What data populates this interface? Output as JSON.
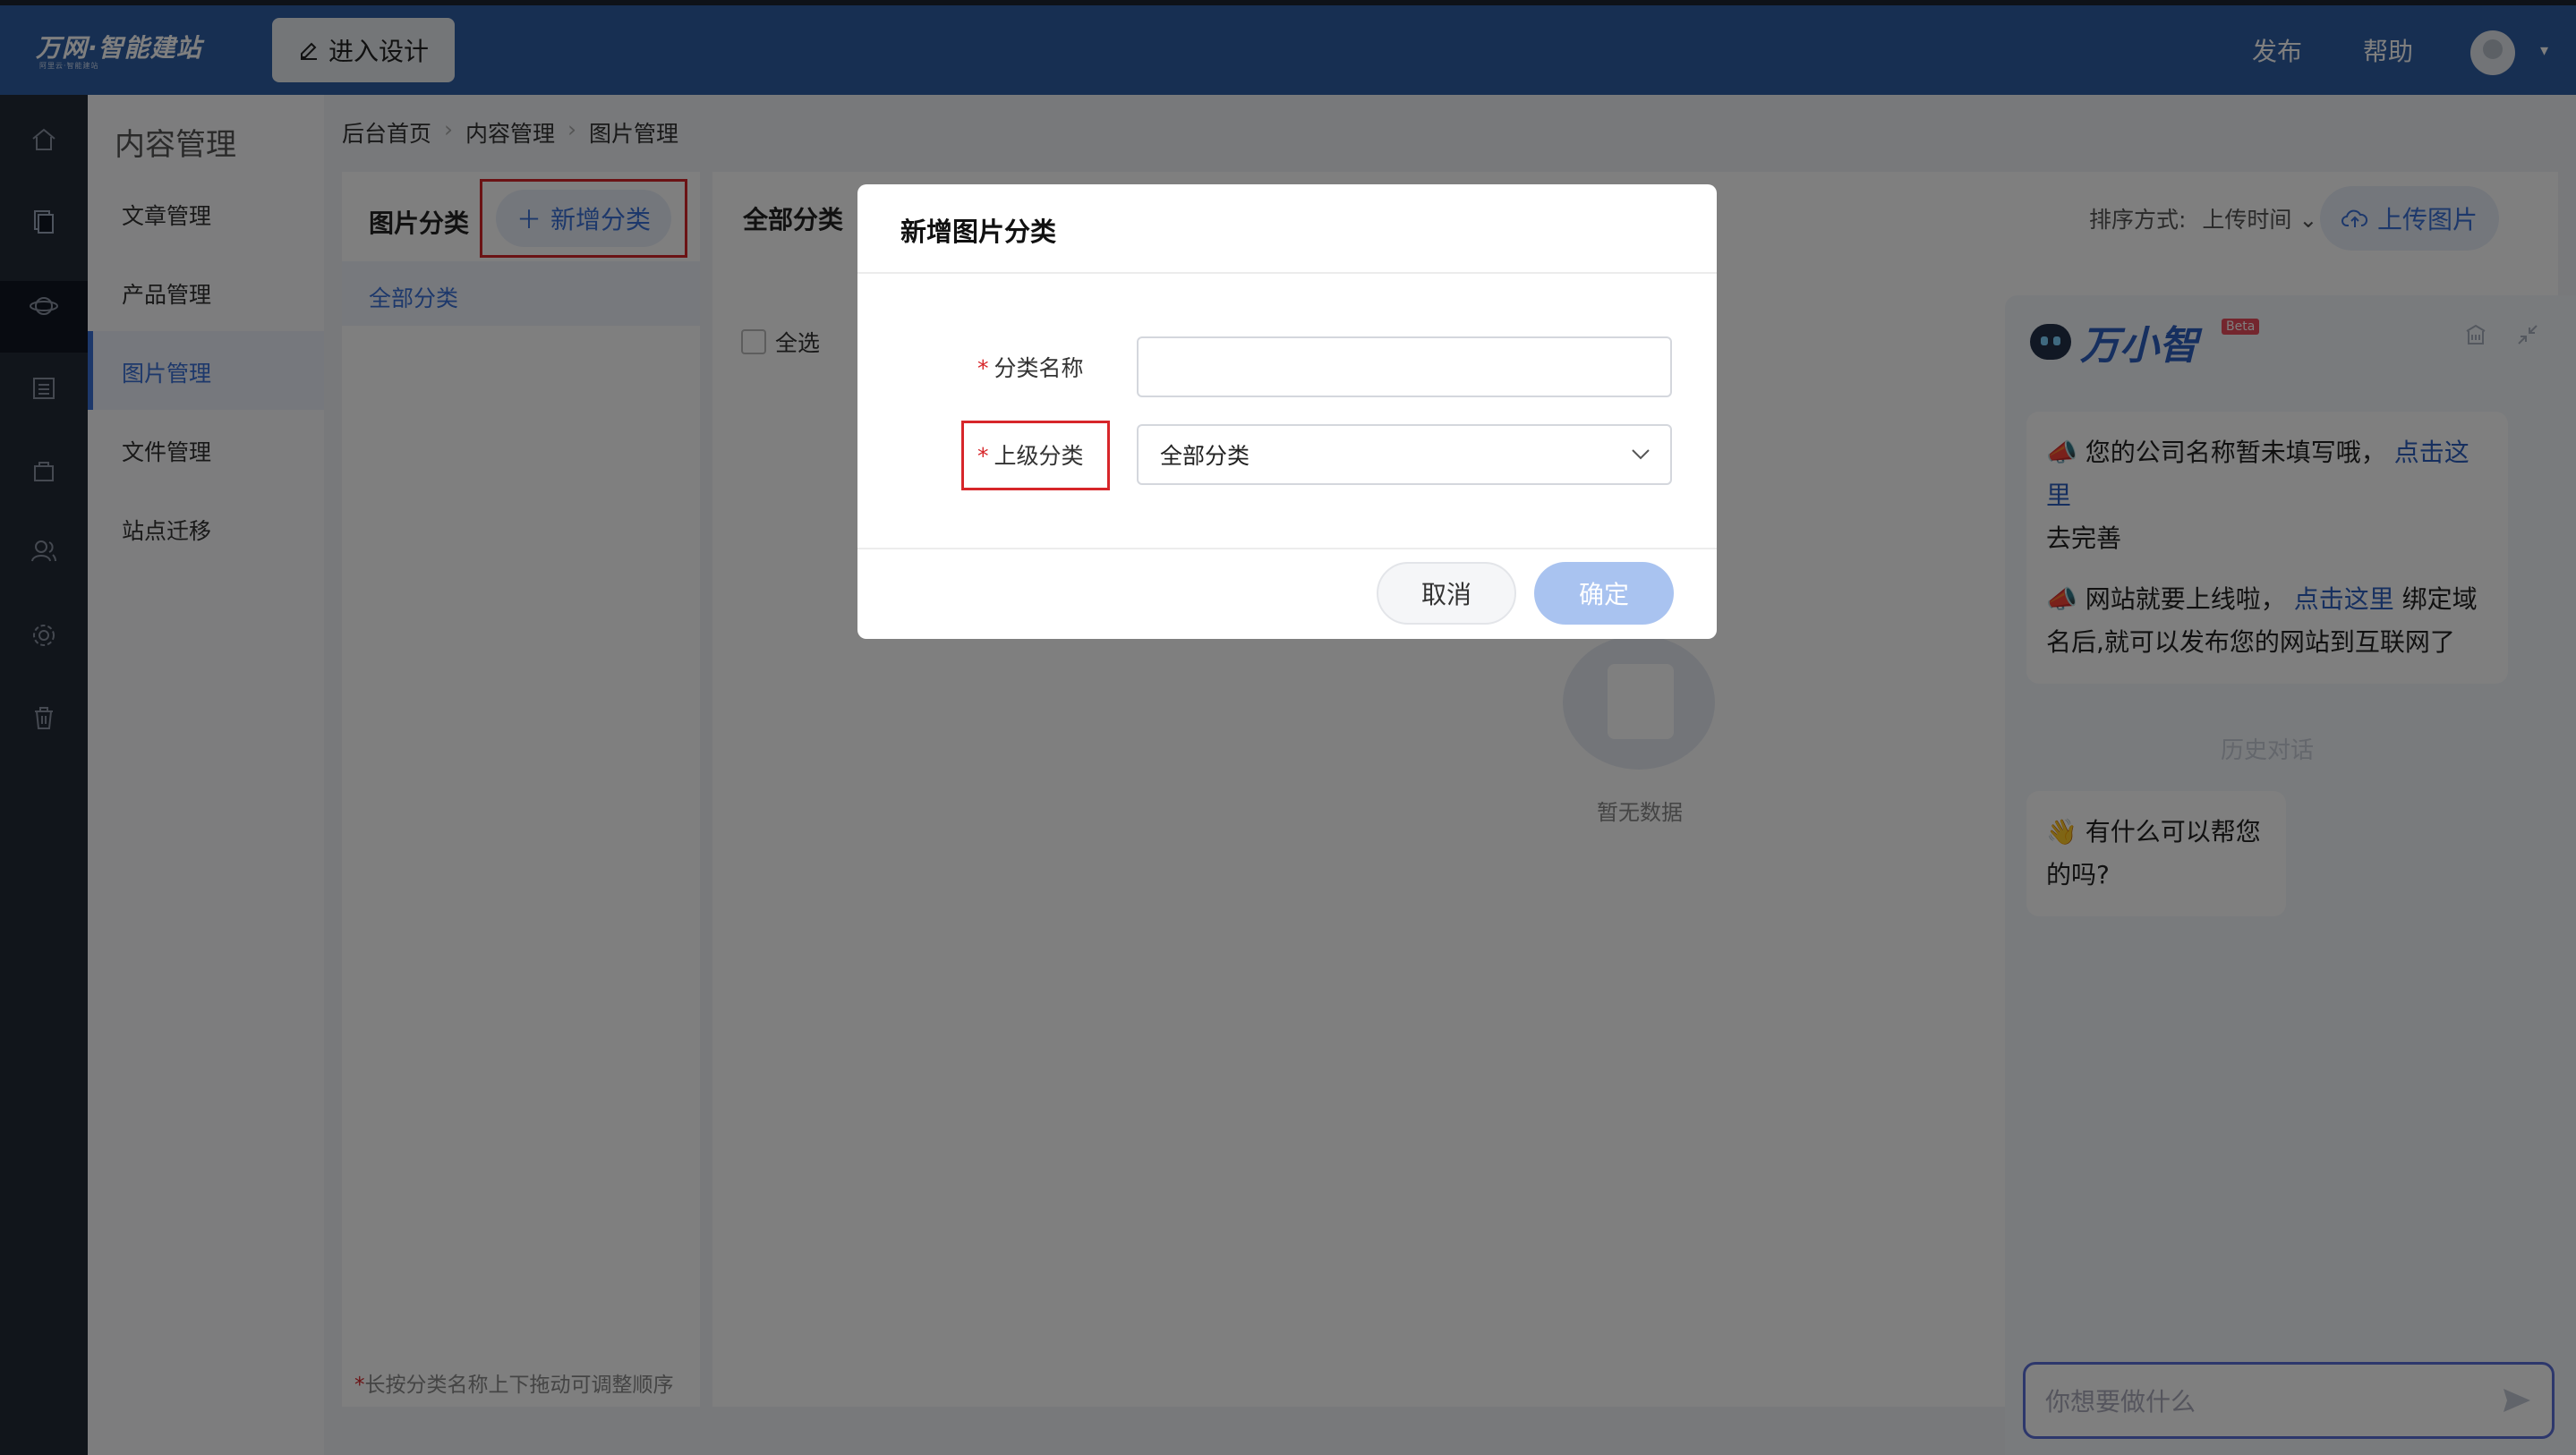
{
  "app": {
    "logo": "万网·智能建站",
    "logo_sub": "阿里云·智能建站",
    "design_button": "进入设计",
    "publish": "发布",
    "help": "帮助"
  },
  "sidebar_icons": [
    "home-icon",
    "content-icon",
    "planet-icon",
    "list-icon",
    "bag-icon",
    "users-icon",
    "gear-icon",
    "trash-icon"
  ],
  "submenu": {
    "title": "内容管理",
    "items": [
      {
        "label": "文章管理"
      },
      {
        "label": "产品管理"
      },
      {
        "label": "图片管理"
      },
      {
        "label": "文件管理"
      },
      {
        "label": "站点迁移"
      }
    ]
  },
  "breadcrumb": [
    "后台首页",
    "内容管理",
    "图片管理"
  ],
  "category_panel": {
    "title": "图片分类",
    "add_button": "新增分类",
    "items": [
      "全部分类"
    ],
    "hint": "长按分类名称上下拖动可调整顺序"
  },
  "main_panel": {
    "title": "全部分类",
    "select_all": "全选",
    "sort_label": "排序方式:",
    "sort_value": "上传时间",
    "upload_button": "上传图片",
    "empty_text": "暂无数据"
  },
  "chat": {
    "brand": "万小智",
    "beta": "Beta",
    "messages": [
      {
        "emoji": "📣",
        "before": "您的公司名称暂未填写哦，",
        "link": "点击这里",
        "after": "去完善"
      },
      {
        "emoji": "📣",
        "before": "网站就要上线啦，",
        "link": "点击这里",
        "after": "绑定域名后,就可以发布您的网站到互联网了"
      }
    ],
    "history_divider": "历史对话",
    "greeting": "👋 有什么可以帮您的吗?",
    "input_placeholder": "你想要做什么"
  },
  "modal": {
    "title": "新增图片分类",
    "name_label": "分类名称",
    "name_value": "",
    "parent_label": "上级分类",
    "parent_value": "全部分类",
    "cancel": "取消",
    "confirm": "确定"
  },
  "colors": {
    "topbar": "#2f5ea4",
    "accent": "#3a70d6",
    "highlight_box": "#d7262a",
    "confirm_disabled": "#a9c3f0"
  }
}
